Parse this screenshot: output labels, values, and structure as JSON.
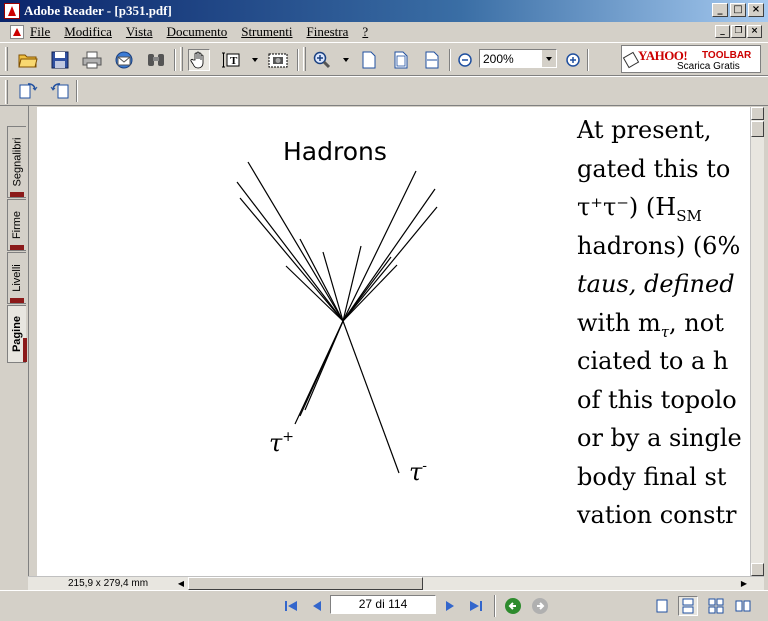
{
  "window": {
    "title": "Adobe Reader - [p351.pdf]",
    "controls": [
      "minimize",
      "maximize",
      "close"
    ]
  },
  "menubar": {
    "items": [
      "File",
      "Modifica",
      "Vista",
      "Documento",
      "Strumenti",
      "Finestra",
      "?"
    ]
  },
  "toolbar": {
    "icons": [
      "open-icon",
      "save-icon",
      "print-icon",
      "email-icon",
      "search-icon",
      "hand-tool-icon",
      "select-text-icon",
      "snapshot-icon",
      "zoom-in-icon",
      "actual-size-icon",
      "fit-page-icon",
      "fit-width-icon",
      "zoom-out-circle-icon",
      "zoom-in-circle-icon"
    ],
    "zoom_value": "200%",
    "yahoo": {
      "logo": "YAHOO!",
      "tool": "TOOLBAR",
      "subtitle": "Scarica Gratis"
    }
  },
  "toolbar2": {
    "icons": [
      "rotate-cw-icon",
      "rotate-ccw-icon"
    ]
  },
  "side_panel": {
    "tabs": [
      "Segnalibri",
      "Firme",
      "Livelli",
      "Pagine"
    ],
    "active_tab": "Pagine"
  },
  "document": {
    "figure": {
      "label_top": "Hadrons",
      "label_tau_plus": "τ",
      "label_tau_plus_sup": "+",
      "label_tau_minus": "τ",
      "label_tau_minus_sup": "-"
    },
    "text_lines": [
      "At present, ",
      "gated this to",
      "τ⁺τ⁻) (H",
      "hadrons) (6%",
      "taus, defined",
      "with m",
      "ciated to a h",
      "of this topolo",
      "or by a single",
      "body final st",
      "vation constr"
    ],
    "text_sub_sm": "SM",
    "text_sub_tau": "τ",
    "text_after_mtau": ", not"
  },
  "hscroll": {
    "page_size": "215,9 x 279,4 mm"
  },
  "statusbar": {
    "page_indicator": "27 di 114"
  },
  "colors": {
    "titlebar_start": "#0a246a",
    "titlebar_end": "#a6caf0",
    "chrome": "#d4d0c8",
    "nav_green": "#2e8b2e",
    "nav_blue": "#3366cc"
  }
}
